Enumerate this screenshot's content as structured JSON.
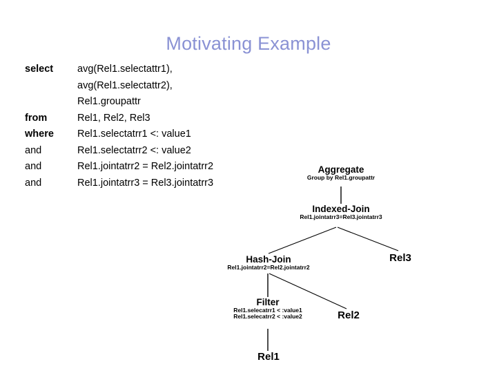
{
  "slide": {
    "title": "Motivating Example"
  },
  "query": {
    "rows": [
      {
        "keyword": "select",
        "bold": true,
        "expression": "avg(Rel1.selectattr1),"
      },
      {
        "keyword": "",
        "bold": false,
        "expression": "avg(Rel1.selectattr2),"
      },
      {
        "keyword": "",
        "bold": false,
        "expression": "Rel1.groupattr"
      },
      {
        "keyword": "from",
        "bold": true,
        "expression": "Rel1, Rel2, Rel3"
      },
      {
        "keyword": "where",
        "bold": true,
        "expression": "Rel1.selectatrr1 <: value1"
      },
      {
        "keyword": "and",
        "bold": false,
        "expression": "Rel1.selectatrr2 <: value2"
      },
      {
        "keyword": "and",
        "bold": false,
        "expression": "Rel1.jointatrr2 = Rel2.jointatrr2"
      },
      {
        "keyword": "and",
        "bold": false,
        "expression": "Rel1.jointatrr3 = Rel3.jointatrr3"
      }
    ]
  },
  "plan": {
    "nodes": {
      "aggregate": {
        "title": "Aggregate",
        "sub": "Group by Rel1.groupattr"
      },
      "indexed_join": {
        "title": "Indexed-Join",
        "sub": "Rel1.jointatrr3=Rel3.jointatrr3"
      },
      "hash_join": {
        "title": "Hash-Join",
        "sub": "Rel1.jointatrr2=Rel2.jointatrr2"
      },
      "filter": {
        "title": "Filter",
        "sub1": "Rel1.selecatrr1 < :value1",
        "sub2": "Rel1.selecatrr2 < :value2"
      },
      "rel1": {
        "title": "Rel1"
      },
      "rel2": {
        "title": "Rel2"
      },
      "rel3": {
        "title": "Rel3"
      }
    }
  },
  "colors": {
    "title": "#8a92d4",
    "text": "#000000",
    "background": "#ffffff",
    "edge": "#000000"
  }
}
